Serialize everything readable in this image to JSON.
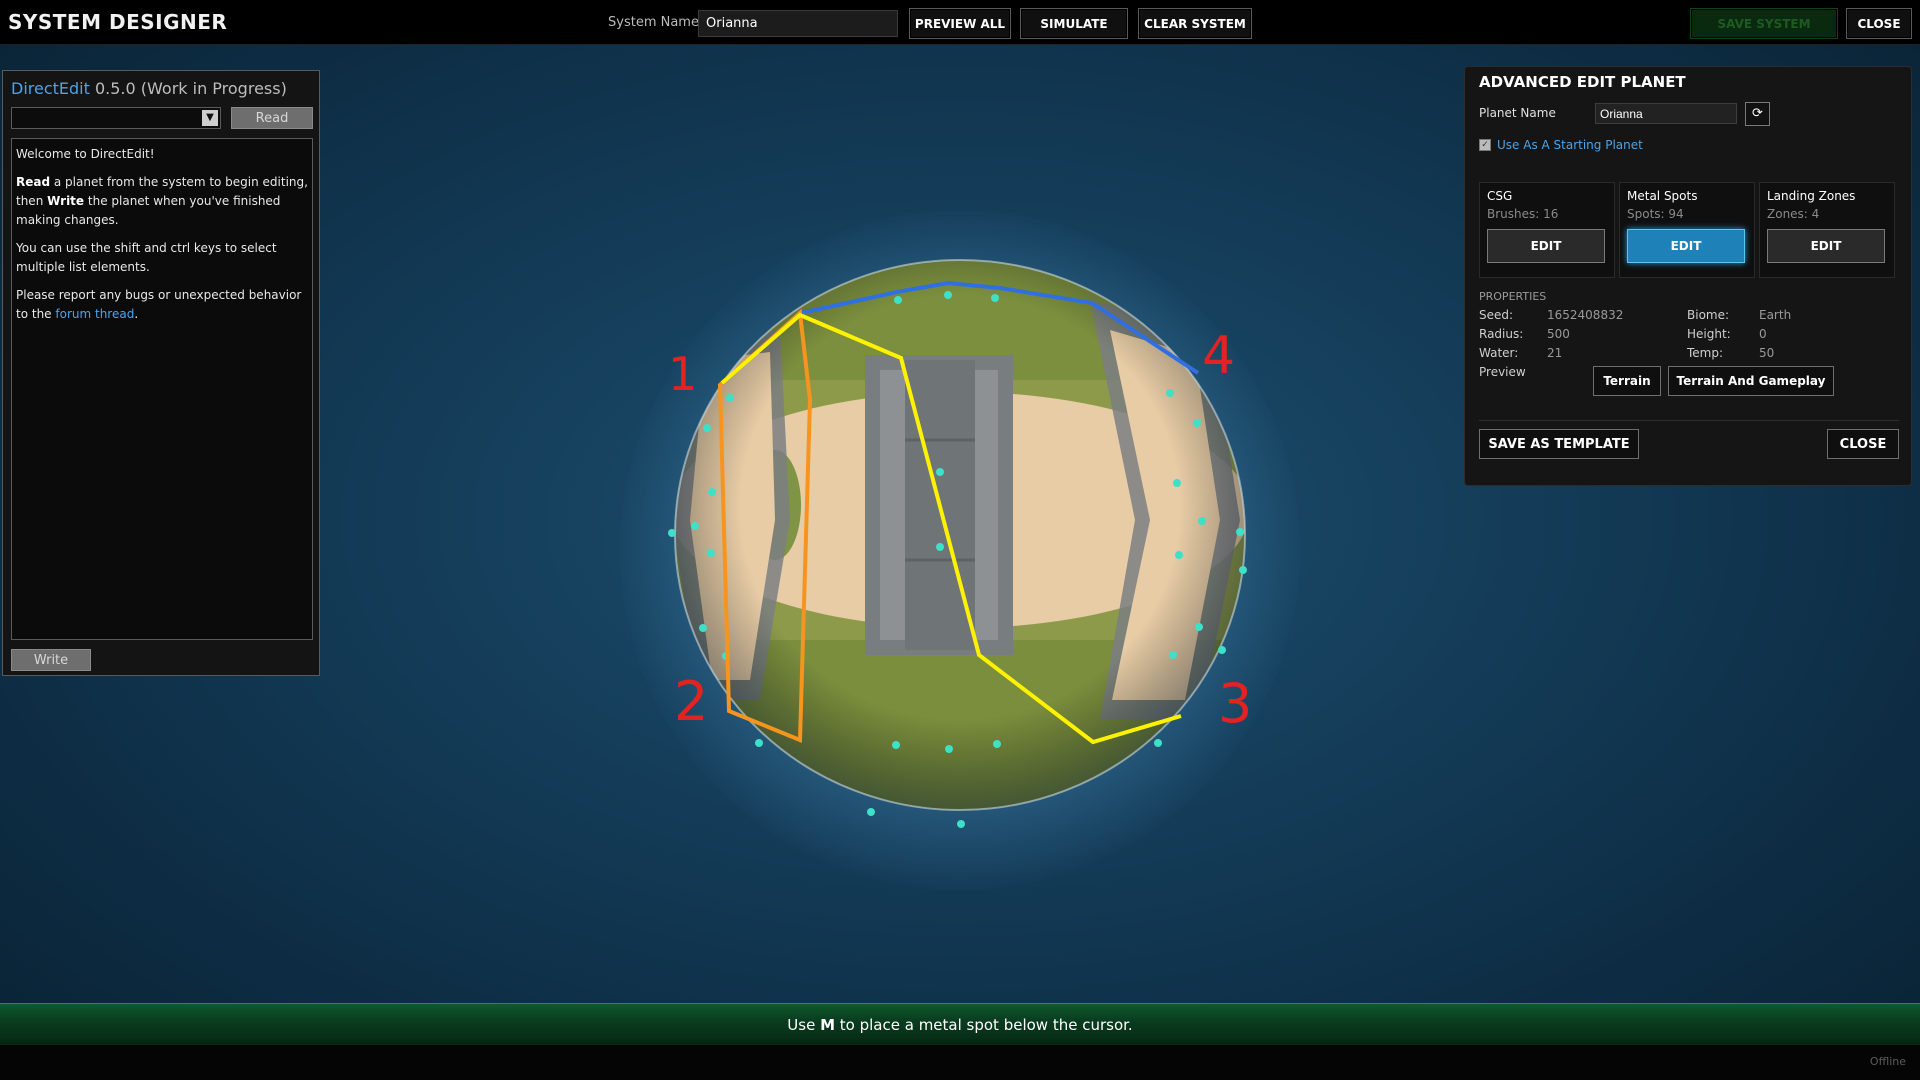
{
  "header": {
    "title": "SYSTEM DESIGNER",
    "system_name_label": "System Name:",
    "system_name_value": "Orianna",
    "buttons": {
      "preview_all": "PREVIEW ALL",
      "simulate": "SIMULATE",
      "clear_system": "CLEAR SYSTEM",
      "save_system": "SAVE SYSTEM",
      "close": "CLOSE"
    }
  },
  "direct_edit": {
    "name": "DirectEdit",
    "version": "0.5.0 (Work in Progress)",
    "read_label": "Read",
    "write_label": "Write",
    "help": {
      "welcome": "Welcome to DirectEdit!",
      "p1_bold1": "Read",
      "p1_mid": " a planet from the system to begin editing, then ",
      "p1_bold2": "Write",
      "p1_end": " the planet when you've finished making changes.",
      "p2": "You can use the shift and ctrl keys to select multiple list elements.",
      "p3_start": "Please report any bugs or unexpected behavior to the ",
      "p3_link": "forum thread",
      "p3_end": "."
    }
  },
  "planet_annotations": {
    "labels": [
      "1",
      "2",
      "3",
      "4"
    ],
    "colors": {
      "orange": "#f7941d",
      "yellow": "#fff200",
      "blue": "#2f6fe0",
      "red": "#e32222",
      "metal_spot": "#3ee0c8"
    }
  },
  "advanced_edit": {
    "title": "ADVANCED EDIT PLANET",
    "planet_name_label": "Planet Name",
    "planet_name_value": "Orianna",
    "starting_planet_label": "Use As A Starting Planet",
    "starting_planet_checked": true,
    "sections": [
      {
        "title": "CSG",
        "subtitle": "Brushes: 16",
        "button": "EDIT",
        "active": false
      },
      {
        "title": "Metal Spots",
        "subtitle": "Spots: 94",
        "button": "EDIT",
        "active": true
      },
      {
        "title": "Landing Zones",
        "subtitle": "Zones: 4",
        "button": "EDIT",
        "active": false
      }
    ],
    "properties_header": "PROPERTIES",
    "properties": {
      "seed_label": "Seed:",
      "seed": "1652408832",
      "radius_label": "Radius:",
      "radius": "500",
      "water_label": "Water:",
      "water": "21",
      "biome_label": "Biome:",
      "biome": "Earth",
      "height_label": "Height:",
      "height": "0",
      "temp_label": "Temp:",
      "temp": "50"
    },
    "preview_label": "Preview",
    "preview_buttons": {
      "terrain": "Terrain",
      "terrain_gameplay": "Terrain And Gameplay"
    },
    "save_template": "SAVE AS TEMPLATE",
    "close": "CLOSE"
  },
  "hint": {
    "pre": "Use ",
    "key": "M",
    "post": " to place a metal spot below the cursor."
  },
  "status": {
    "connection": "Offline"
  }
}
